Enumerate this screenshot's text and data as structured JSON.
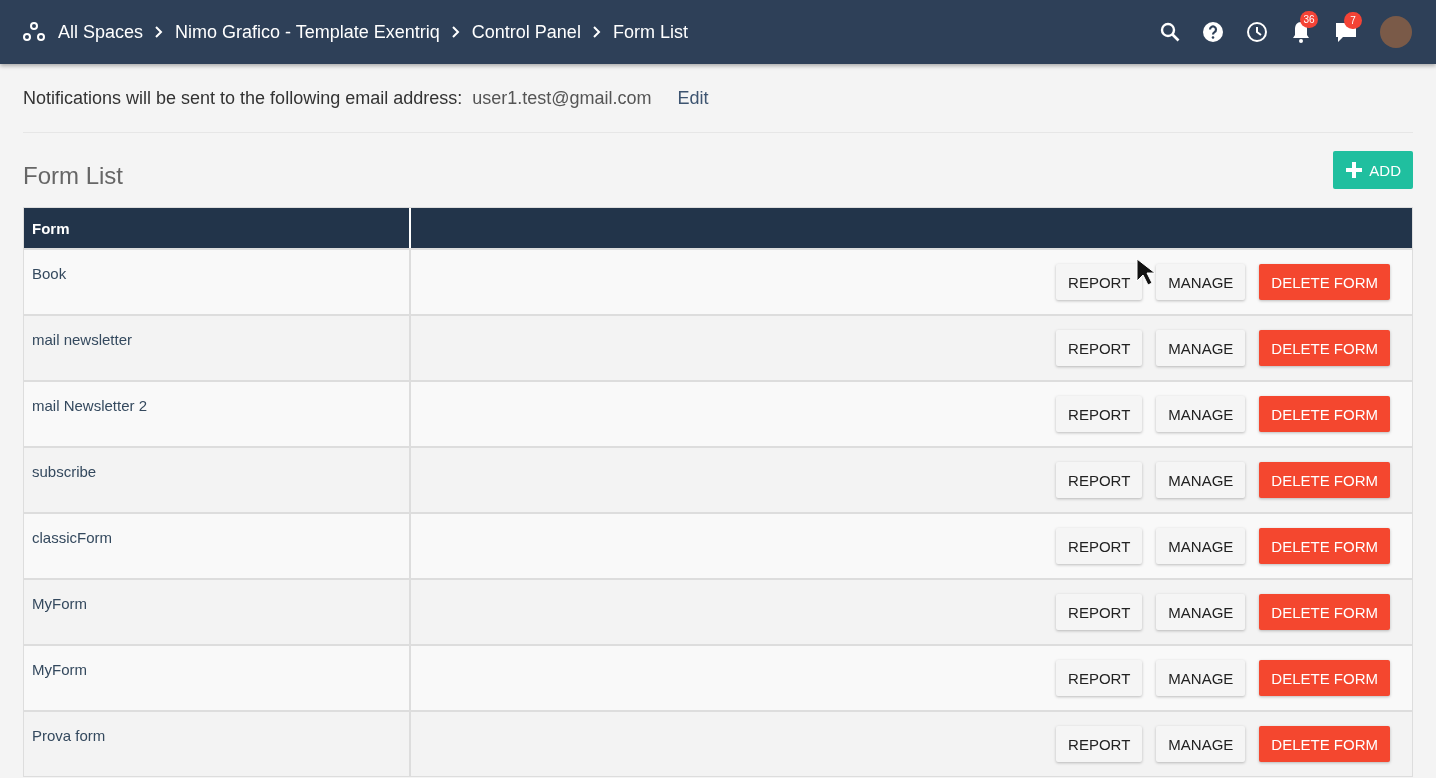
{
  "breadcrumb": [
    "All Spaces",
    "Nimo Grafico - Template Exentriq",
    "Control Panel",
    "Form List"
  ],
  "topbar": {
    "notifications_badge": "36",
    "messages_badge": "7"
  },
  "notice": {
    "text": "Notifications will be sent to the following email address:",
    "email": "user1.test@gmail.com",
    "edit": "Edit"
  },
  "section_title": "Form List",
  "add_button": "ADD",
  "table": {
    "columns": [
      "Form"
    ],
    "rows": [
      {
        "name": "Book",
        "pointer": true,
        "actions": [
          "REPORT",
          "MANAGE",
          "DELETE FORM"
        ]
      },
      {
        "name": "mail newsletter",
        "pointer": false,
        "actions": [
          "REPORT",
          "MANAGE",
          "DELETE FORM"
        ]
      },
      {
        "name": "mail Newsletter 2",
        "pointer": false,
        "actions": [
          "REPORT",
          "MANAGE",
          "DELETE FORM"
        ]
      },
      {
        "name": "subscribe",
        "pointer": false,
        "actions": [
          "REPORT",
          "MANAGE",
          "DELETE FORM"
        ]
      },
      {
        "name": "classicForm",
        "pointer": false,
        "actions": [
          "REPORT",
          "MANAGE",
          "DELETE FORM"
        ]
      },
      {
        "name": "MyForm",
        "pointer": false,
        "actions": [
          "REPORT",
          "MANAGE",
          "DELETE FORM"
        ]
      },
      {
        "name": "MyForm",
        "pointer": false,
        "actions": [
          "REPORT",
          "MANAGE",
          "DELETE FORM"
        ]
      },
      {
        "name": "Prova form",
        "pointer": false,
        "actions": [
          "REPORT",
          "MANAGE",
          "DELETE FORM"
        ]
      }
    ]
  }
}
